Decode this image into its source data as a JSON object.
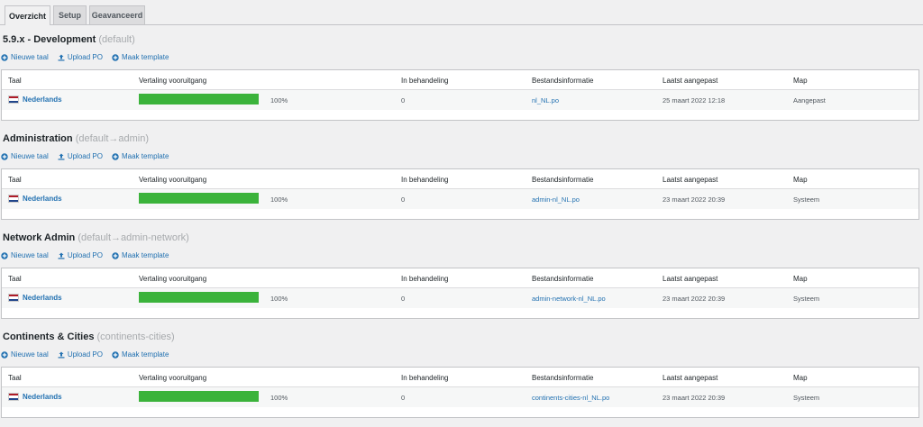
{
  "tabs": [
    {
      "label": "Overzicht",
      "active": true
    },
    {
      "label": "Setup",
      "active": false
    },
    {
      "label": "Geavanceerd",
      "active": false
    }
  ],
  "columns": [
    "Taal",
    "Vertaling vooruitgang",
    "In behandeling",
    "Bestandsinformatie",
    "Laatst aangepast",
    "Map"
  ],
  "actions": [
    "Nieuwe taal",
    "Upload PO",
    "Maak template"
  ],
  "colors": {
    "accent": "#2271b1",
    "progress": "#3bb33b",
    "flag_red": "#ae1c28",
    "flag_blue": "#21468b"
  },
  "sections": [
    {
      "title": "5.9.x - Development",
      "subtitle": "(default)",
      "row": {
        "language": "Nederlands",
        "progress": 1.0,
        "percent": "100%",
        "pending": "0",
        "file": "nl_NL.po",
        "modified": "25 maart 2022 12:18",
        "folder": "Aangepast"
      }
    },
    {
      "title": "Administration",
      "subtitle": "(default→admin)",
      "row": {
        "language": "Nederlands",
        "progress": 1.0,
        "percent": "100%",
        "pending": "0",
        "file": "admin-nl_NL.po",
        "modified": "23 maart 2022 20:39",
        "folder": "Systeem"
      }
    },
    {
      "title": "Network Admin",
      "subtitle": "(default→admin-network)",
      "row": {
        "language": "Nederlands",
        "progress": 1.0,
        "percent": "100%",
        "pending": "0",
        "file": "admin-network-nl_NL.po",
        "modified": "23 maart 2022 20:39",
        "folder": "Systeem"
      }
    },
    {
      "title": "Continents & Cities",
      "subtitle": "(continents-cities)",
      "row": {
        "language": "Nederlands",
        "progress": 1.0,
        "percent": "100%",
        "pending": "0",
        "file": "continents-cities-nl_NL.po",
        "modified": "23 maart 2022 20:39",
        "folder": "Systeem"
      }
    }
  ]
}
